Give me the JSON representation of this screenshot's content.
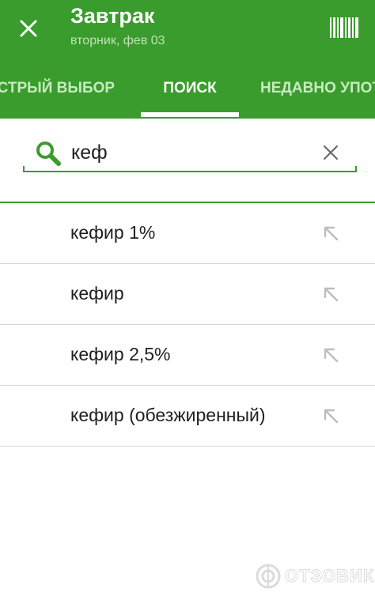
{
  "header": {
    "title": "Завтрак",
    "subtitle": "вторник, фев 03",
    "close_icon": "close-icon",
    "barcode_icon": "barcode-icon"
  },
  "tabs": [
    {
      "label": "ЫСТРЫЙ ВЫБОР",
      "active": false
    },
    {
      "label": "ПОИСК",
      "active": true
    },
    {
      "label": "НЕДАВНО УПОТ",
      "active": false
    }
  ],
  "search": {
    "value": "кеф",
    "icon": "search-icon",
    "clear_icon": "clear-icon"
  },
  "results": [
    {
      "label": "кефир 1%"
    },
    {
      "label": "кефир"
    },
    {
      "label": "кефир 2,5%"
    },
    {
      "label": "кефир (обезжиренный)"
    }
  ],
  "watermark": {
    "text": "ОТЗОВИК"
  },
  "colors": {
    "accent": "#3a9c2c",
    "tab_inactive": "#c9e9c2",
    "divider": "#d6d6d6"
  }
}
